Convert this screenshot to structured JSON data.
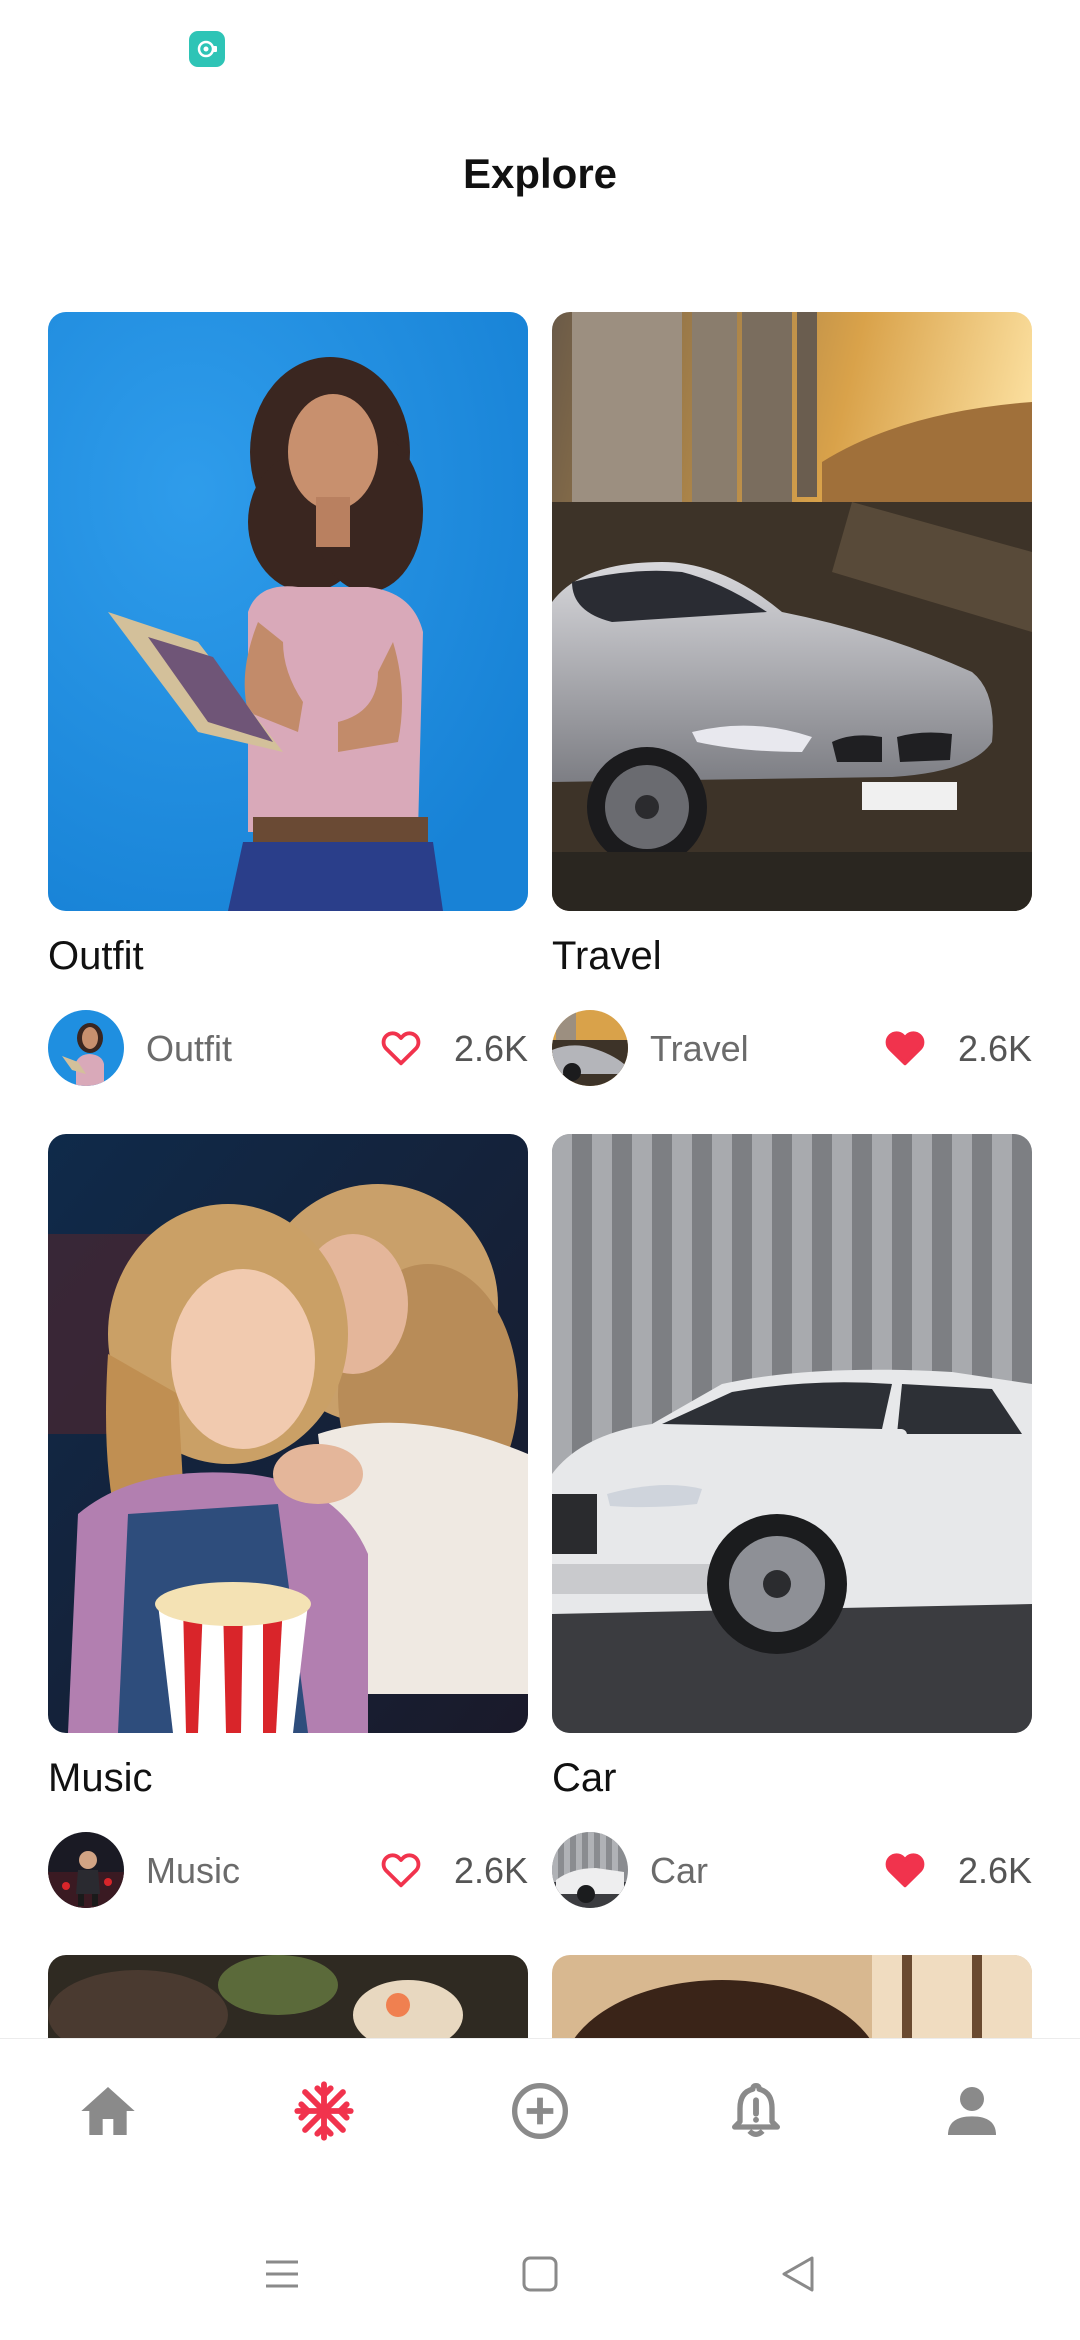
{
  "page": {
    "title": "Explore"
  },
  "colors": {
    "accent": "#f1334d",
    "nav_inactive": "#8a8a8a",
    "status_icon": "#2ec4b6"
  },
  "cards": [
    {
      "title": "Outfit",
      "author": "Outfit",
      "likes": "2.6K",
      "liked": false,
      "image": "woman-reading-book-photo"
    },
    {
      "title": "Travel",
      "author": "Travel",
      "likes": "2.6K",
      "liked": true,
      "image": "silver-sports-car-sunset-photo"
    },
    {
      "title": "Music",
      "author": "Music",
      "likes": "2.6K",
      "liked": false,
      "image": "mother-daughter-popcorn-photo"
    },
    {
      "title": "Car",
      "author": "Car",
      "likes": "2.6K",
      "liked": true,
      "image": "white-suv-photo"
    }
  ],
  "bottom_nav": [
    {
      "name": "home",
      "icon": "home-icon",
      "active": false
    },
    {
      "name": "explore",
      "icon": "snowflake-icon",
      "active": true
    },
    {
      "name": "create",
      "icon": "add-circle-icon",
      "active": false
    },
    {
      "name": "notifications",
      "icon": "bell-alert-icon",
      "active": false
    },
    {
      "name": "profile",
      "icon": "person-icon",
      "active": false
    }
  ],
  "system_nav": [
    "menu-icon",
    "home-square-icon",
    "back-triangle-icon"
  ]
}
